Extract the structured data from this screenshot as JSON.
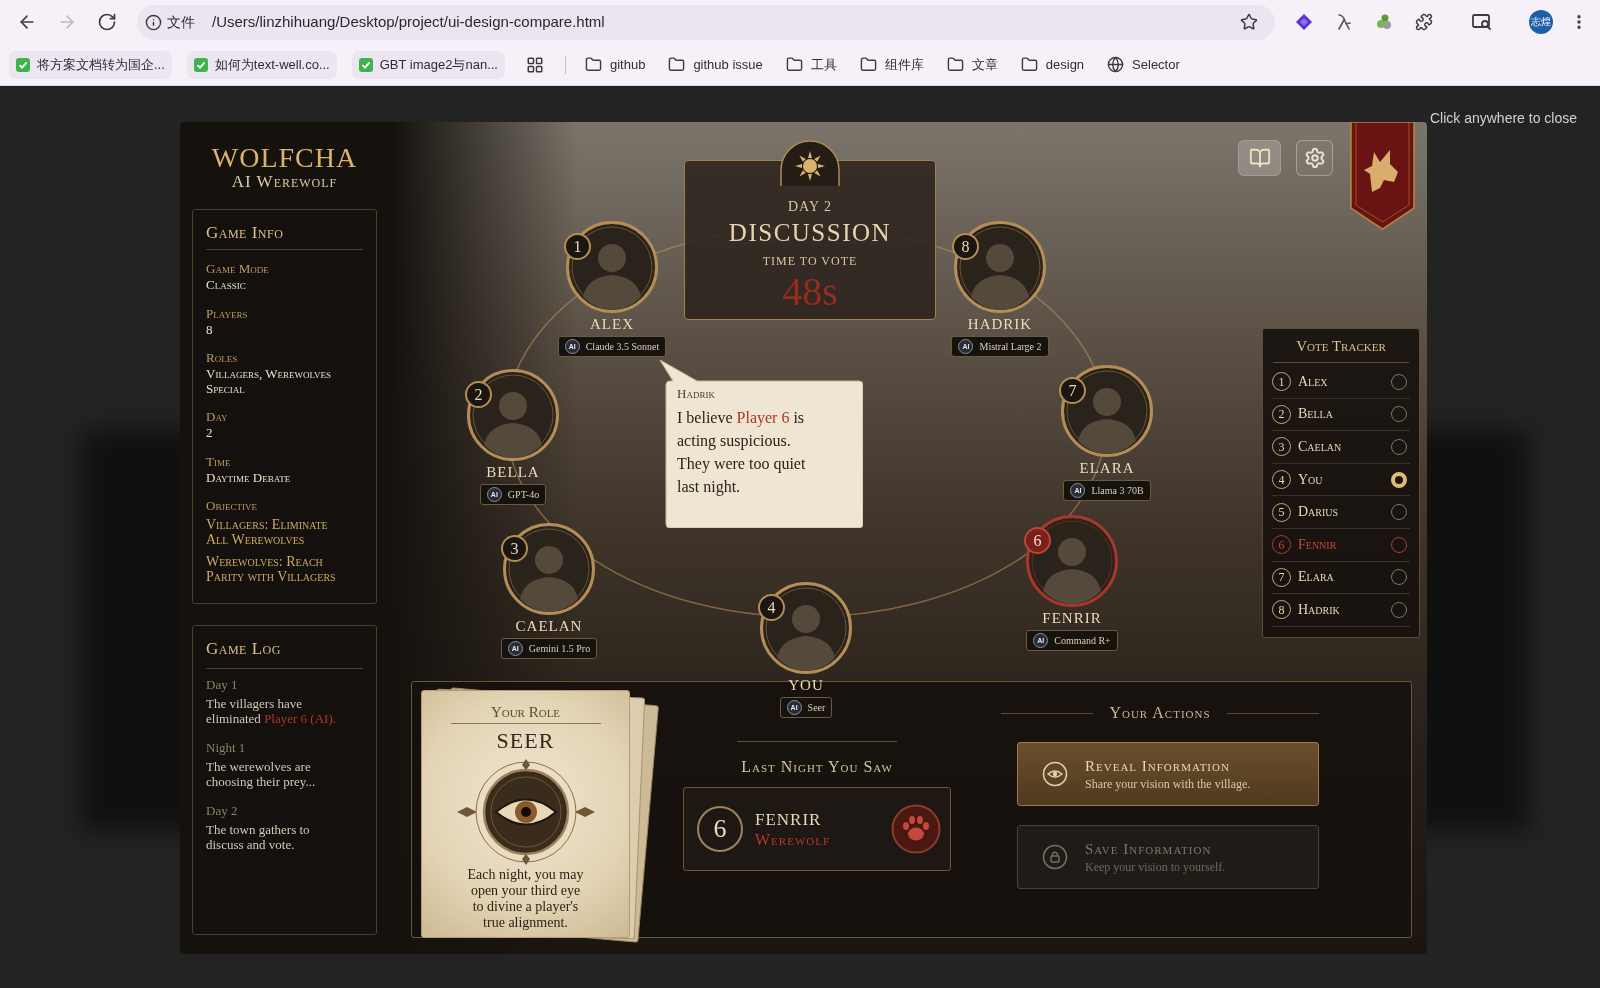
{
  "browser": {
    "nav": [
      {
        "kind": "back",
        "disabled": false
      },
      {
        "kind": "forward",
        "disabled": true
      },
      {
        "kind": "reload",
        "disabled": false
      }
    ],
    "address_bar": {
      "scheme_label": "文件",
      "url": "/Users/linzhihuang/Desktop/project/ui-design-compare.html"
    },
    "profile": {
      "initials": "志煌"
    },
    "bookmarks": [
      {
        "kind": "check",
        "label": "将方案文档转为国企..."
      },
      {
        "kind": "check",
        "label": "如何为text-well.co..."
      },
      {
        "kind": "check",
        "label": "GBT image2与nan..."
      },
      {
        "kind": "apps"
      },
      {
        "kind": "folder",
        "label": "github"
      },
      {
        "kind": "folder",
        "label": "github issue"
      },
      {
        "kind": "folder",
        "label": "工具"
      },
      {
        "kind": "folder",
        "label": "组件库"
      },
      {
        "kind": "folder",
        "label": "文章"
      },
      {
        "kind": "folder",
        "label": "design"
      },
      {
        "kind": "site",
        "label": "Selector"
      }
    ]
  },
  "overlay": {
    "close_hint": "Click anywhere to close"
  },
  "game": {
    "logo": {
      "title": "WOLFCHA",
      "subtitle": "AI Werewolf"
    },
    "game_info": {
      "title": "Game Info",
      "fields": [
        {
          "label": "Game Mode",
          "value": "Classic"
        },
        {
          "label": "Players",
          "value": "8"
        },
        {
          "label": "Roles",
          "value": "Villagers, Werewolves Special"
        },
        {
          "label": "Day",
          "value": "2"
        },
        {
          "label": "Time",
          "value": "Daytime Debate"
        }
      ],
      "objective": {
        "label": "Objective",
        "goals": [
          "Villagers: Eliminate All Werewolves",
          "Werewolves: Reach Parity with Villagers"
        ]
      }
    },
    "game_log": {
      "title": "Game Log",
      "entries": [
        {
          "phase": "Day 1",
          "parts": [
            {
              "text": "The villagers have eliminated ",
              "highlight": false
            },
            {
              "text": "Player 6 (AI).",
              "highlight": true
            }
          ]
        },
        {
          "phase": "Night 1",
          "parts": [
            {
              "text": "The werewolves are choosing their prey...",
              "highlight": false
            }
          ]
        },
        {
          "phase": "Day 2",
          "parts": [
            {
              "text": "The town gathers to discuss and vote.",
              "highlight": false
            }
          ]
        }
      ]
    },
    "phase_panel": {
      "day": "DAY 2",
      "phase": "DISCUSSION",
      "timer_label": "TIME TO VOTE",
      "timer": "48s"
    },
    "players": [
      {
        "number": "1",
        "name": "ALEX",
        "tag": "AI",
        "badge_text": "Claude 3.5 Sonnet",
        "flagged": false
      },
      {
        "number": "2",
        "name": "BELLA",
        "tag": "AI",
        "badge_text": "GPT-4o",
        "flagged": false
      },
      {
        "number": "3",
        "name": "CAELAN",
        "tag": "AI",
        "badge_text": "Gemini 1.5 Pro",
        "flagged": false
      },
      {
        "number": "4",
        "name": "YOU",
        "tag": "AI",
        "badge_text": "Seer",
        "flagged": false
      },
      {
        "number": "6",
        "name": "FENRIR",
        "tag": "AI",
        "badge_text": "Command R+",
        "flagged": true
      },
      {
        "number": "7",
        "name": "ELARA",
        "tag": "AI",
        "badge_text": "Llama 3 70B",
        "flagged": false
      },
      {
        "number": "8",
        "name": "HADRIK",
        "tag": "AI",
        "badge_text": "Mistral Large 2",
        "flagged": false
      }
    ],
    "speech": {
      "speaker": "Hadrik",
      "parts": [
        {
          "text": "I believe ",
          "highlight": false
        },
        {
          "text": "Player 6",
          "highlight": true
        },
        {
          "text": " is acting suspicious. They were too quiet last night.",
          "highlight": false
        }
      ]
    },
    "vote_tracker": {
      "title": "Vote Tracker",
      "entries": [
        {
          "number": "1",
          "name": "Alex",
          "selected": false,
          "flagged": false
        },
        {
          "number": "2",
          "name": "Bella",
          "selected": false,
          "flagged": false
        },
        {
          "number": "3",
          "name": "Caelan",
          "selected": false,
          "flagged": false
        },
        {
          "number": "4",
          "name": "You",
          "selected": true,
          "flagged": false
        },
        {
          "number": "5",
          "name": "Darius",
          "selected": false,
          "flagged": false
        },
        {
          "number": "6",
          "name": "Fennir",
          "selected": false,
          "flagged": true
        },
        {
          "number": "7",
          "name": "Elara",
          "selected": false,
          "flagged": false
        },
        {
          "number": "8",
          "name": "Hadrik",
          "selected": false,
          "flagged": false
        }
      ]
    },
    "role_card": {
      "title": "Your Role",
      "role": "SEER",
      "description": "Each night, you may open your third eye to divine a player's true alignment."
    },
    "vision": {
      "title": "Last Night You Saw",
      "number": "6",
      "name": "FENRIR",
      "role": "Werewolf"
    },
    "actions": {
      "title": "Your Actions",
      "items": [
        {
          "kind": "reveal",
          "label": "Reveal Information",
          "description": "Share your vision with the village.",
          "selected": true
        },
        {
          "kind": "save",
          "label": "Save Information",
          "description": "Keep your vision to yourself.",
          "selected": false
        }
      ]
    }
  }
}
